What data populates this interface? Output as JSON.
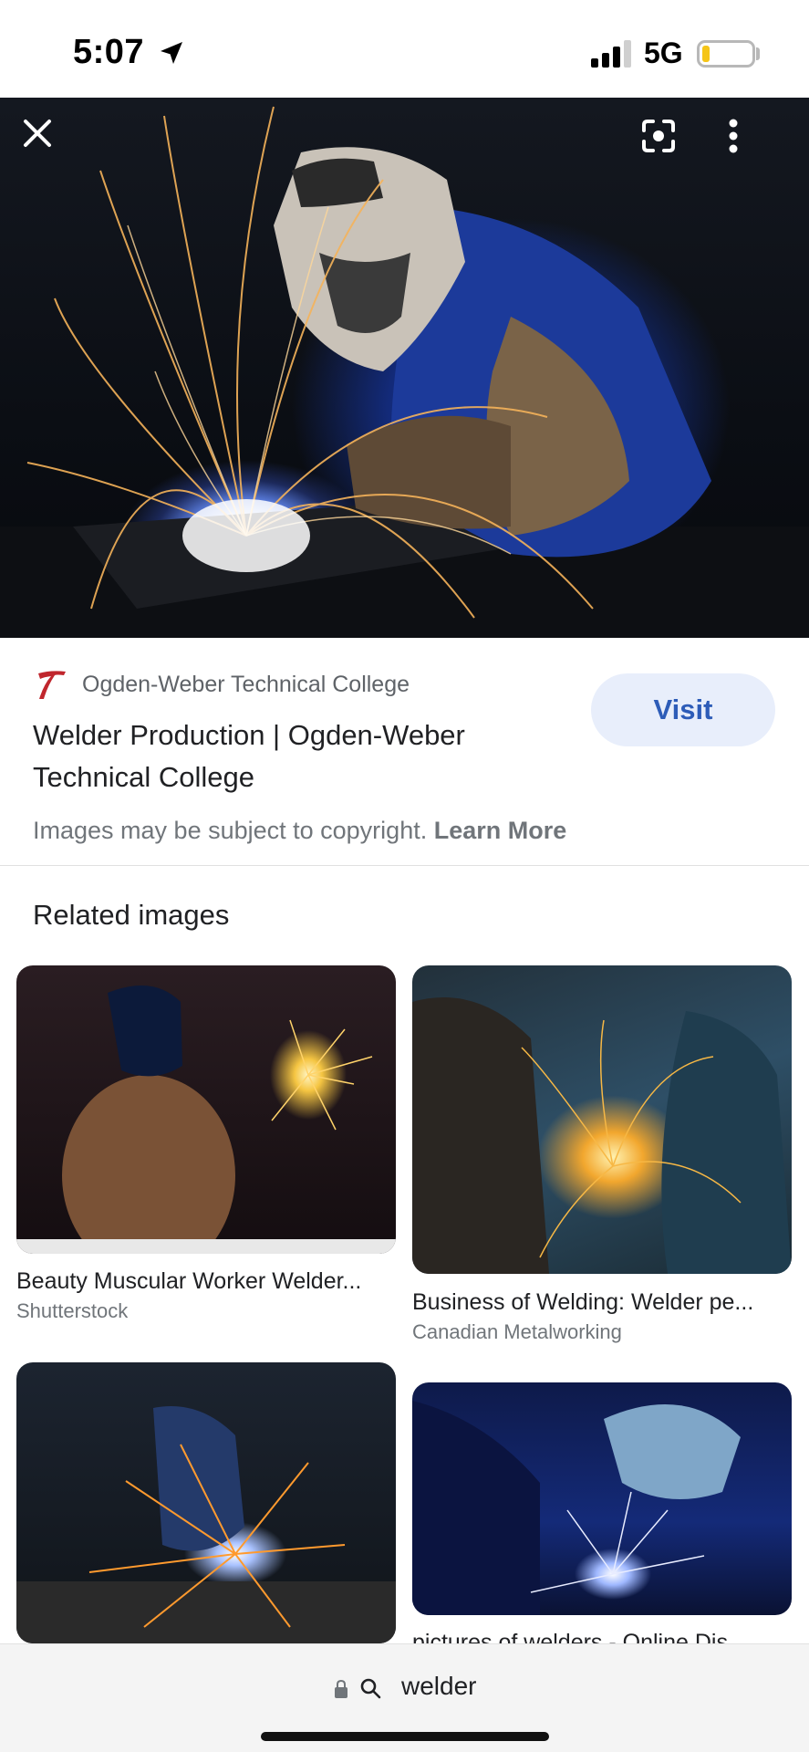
{
  "status_bar": {
    "time": "5:07",
    "network": "5G",
    "battery_level": 0.15
  },
  "viewer": {
    "close_icon": "close-icon",
    "lens_icon": "google-lens-icon",
    "more_icon": "more-vert-icon"
  },
  "source": {
    "name": "Ogden-Weber Technical College",
    "title": "Welder Production | Ogden-Weber Technical College",
    "visit_label": "Visit",
    "copyright_text": "Images may be subject to copyright.",
    "learn_more_label": "Learn More"
  },
  "related": {
    "heading": "Related images",
    "items": [
      {
        "title": "Beauty Muscular Worker Welder...",
        "source": "Shutterstock"
      },
      {
        "title": "Business of Welding: Welder pe...",
        "source": "Canadian Metalworking"
      },
      {
        "title": "",
        "source": ""
      },
      {
        "title": "pictures of welders - Online Dis...",
        "source": ""
      }
    ]
  },
  "search": {
    "query": "welder"
  },
  "colors": {
    "visit_bg": "#e8eefb",
    "visit_text": "#2d5cb8",
    "battery": "#f5c518"
  }
}
